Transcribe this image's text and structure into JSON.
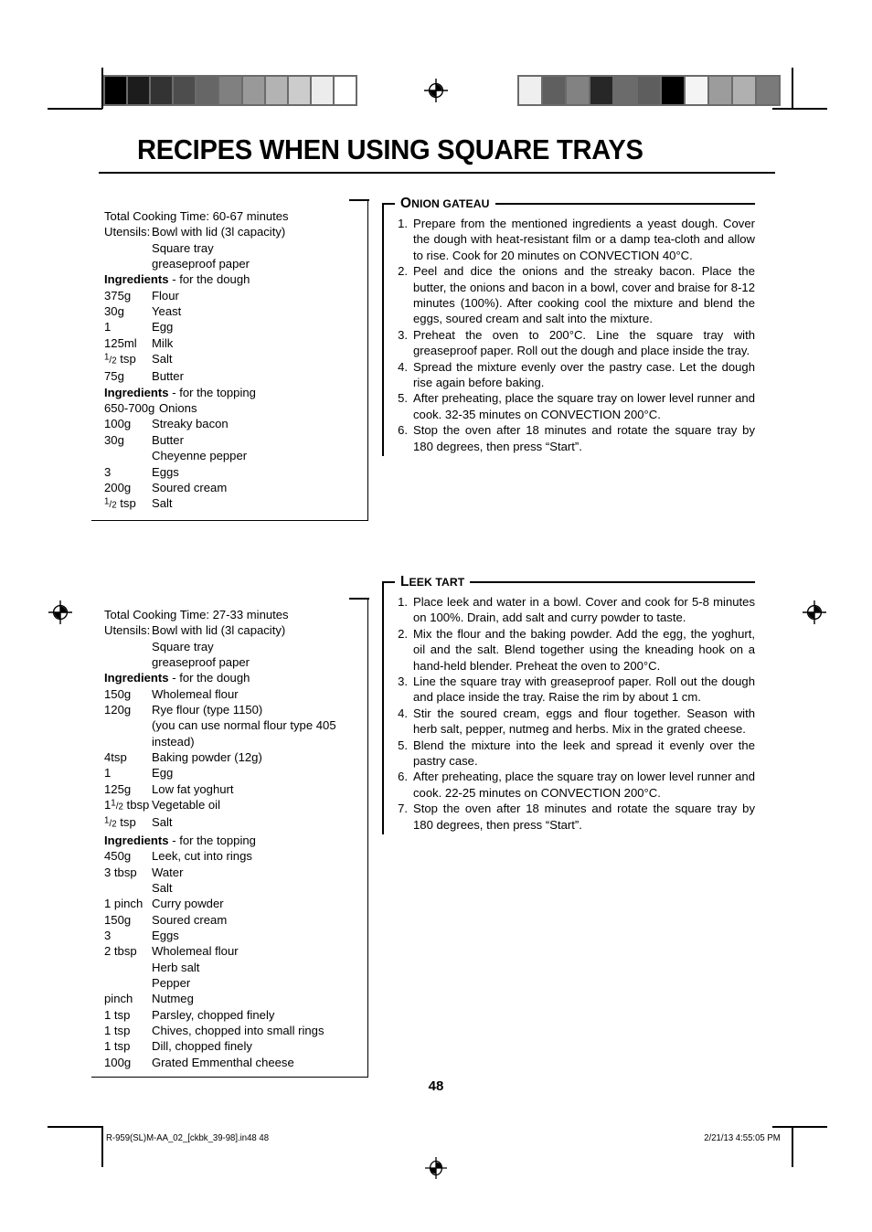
{
  "page_title": "RECIPES WHEN USING SQUARE TRAYS",
  "page_number": "48",
  "footer": {
    "file": "R-959(SL)M-AA_02_[ckbk_39-98].in48   48",
    "timestamp": "2/21/13   4:55:05 PM"
  },
  "print_marks": {
    "left_bar_label": "grayscale-step-wedge",
    "left_bar_colors": [
      "#000000",
      "#1c1c1c",
      "#333333",
      "#4d4d4d",
      "#666666",
      "#808080",
      "#999999",
      "#b3b3b3",
      "#cccccc",
      "#ececec",
      "#ffffff"
    ],
    "right_bar_colors": [
      "#efefef",
      "#5f5f5f",
      "#828282",
      "#272727",
      "#6b6b6b",
      "#5e5e5e",
      "#000000",
      "#f4f4f4",
      "#9c9c9c",
      "#b0b0b0",
      "#7a7a7a"
    ],
    "registration_icon": "registration-target-icon"
  },
  "recipes": [
    {
      "id": "onion-gateau",
      "title_first": "O",
      "title_rest": "NION GATEAU",
      "ingredients": {
        "cooking_time_label": "Total Cooking Time:",
        "cooking_time_value": "60-67 minutes",
        "utensils_label": "Utensils:",
        "utensils": [
          "Bowl with lid (3l capacity)",
          "Square tray",
          "greaseproof paper"
        ],
        "sections": [
          {
            "heading_bold": "Ingredients",
            "heading_rest": " - for the dough",
            "items": [
              {
                "qty": "375g",
                "name": "Flour"
              },
              {
                "qty": "30g",
                "name": "Yeast"
              },
              {
                "qty": "1",
                "name": "Egg"
              },
              {
                "qty": "125ml",
                "name": "Milk"
              },
              {
                "qty": "1/2 tsp",
                "qty_frac": true,
                "qty_num": "1",
                "qty_den": "2",
                "qty_unit": " tsp",
                "name": "Salt"
              },
              {
                "qty": "75g",
                "name": "Butter"
              }
            ]
          },
          {
            "heading_bold": "Ingredients",
            "heading_rest": " - for the topping",
            "items": [
              {
                "qty": "650-700g",
                "name": "Onions",
                "wide": true
              },
              {
                "qty": "100g",
                "name": "Streaky bacon"
              },
              {
                "qty": "30g",
                "name": "Butter"
              },
              {
                "qty": "",
                "name": "Cheyenne pepper"
              },
              {
                "qty": "3",
                "name": "Eggs"
              },
              {
                "qty": "200g",
                "name": "Soured cream"
              },
              {
                "qty": "1/2 tsp",
                "qty_frac": true,
                "qty_num": "1",
                "qty_den": "2",
                "qty_unit": " tsp",
                "name": "Salt"
              }
            ]
          }
        ]
      },
      "steps": [
        "Prepare from the mentioned ingredients a yeast dough. Cover the dough with heat-resistant film or a damp tea-cloth and allow to rise. Cook for 20 minutes on CONVECTION 40°C.",
        "Peel and dice the onions and the streaky bacon. Place the butter, the onions and bacon in a bowl, cover and braise for 8-12 minutes (100%). After cooking cool the mixture and blend the eggs, soured cream and salt into the mixture.",
        "Preheat the oven to 200°C. Line the square tray with greaseproof paper. Roll out the dough and place inside the tray.",
        "Spread the mixture evenly over the pastry case. Let the dough rise again before baking.",
        "After preheating, place the square tray on lower level runner and cook. 32-35 minutes on CONVECTION 200°C.",
        "Stop the oven after 18 minutes and rotate the square tray by 180 degrees, then press “Start”."
      ]
    },
    {
      "id": "leek-tart",
      "title_first": "L",
      "title_rest": "EEK TART",
      "ingredients": {
        "cooking_time_label": "Total Cooking Time:",
        "cooking_time_value": "27-33 minutes",
        "utensils_label": "Utensils:",
        "utensils": [
          "Bowl with lid (3l capacity)",
          "Square tray",
          "greaseproof paper"
        ],
        "sections": [
          {
            "heading_bold": "Ingredients",
            "heading_rest": " - for the dough",
            "items": [
              {
                "qty": "150g",
                "name": "Wholemeal flour"
              },
              {
                "qty": "120g",
                "name": "Rye flour (type 1150)"
              },
              {
                "qty": "",
                "name": "(you can use normal flour type 405",
                "overflow": true
              },
              {
                "qty": "",
                "name": "instead)"
              },
              {
                "qty": "4tsp",
                "name": "Baking powder (12g)"
              },
              {
                "qty": "1",
                "name": "Egg"
              },
              {
                "qty": "125g",
                "name": "Low fat yoghurt"
              },
              {
                "qty": "1 1/2 tbsp",
                "qty_frac": true,
                "qty_whole": "1",
                "qty_num": "1",
                "qty_den": "2",
                "qty_unit": " tbsp",
                "name": "Vegetable oil"
              },
              {
                "qty": "1/2 tsp",
                "qty_frac": true,
                "qty_num": "1",
                "qty_den": "2",
                "qty_unit": " tsp",
                "name": "Salt"
              }
            ]
          },
          {
            "heading_bold": "Ingredients",
            "heading_rest": " - for the topping",
            "items": [
              {
                "qty": "450g",
                "name": "Leek, cut into rings"
              },
              {
                "qty": "3 tbsp",
                "name": "Water"
              },
              {
                "qty": "",
                "name": "Salt"
              },
              {
                "qty": "1 pinch",
                "name": "Curry powder"
              },
              {
                "qty": "150g",
                "name": "Soured cream"
              },
              {
                "qty": "3",
                "name": "Eggs"
              },
              {
                "qty": "2 tbsp",
                "name": "Wholemeal flour"
              },
              {
                "qty": "",
                "name": "Herb salt"
              },
              {
                "qty": "",
                "name": "Pepper"
              },
              {
                "qty": "pinch",
                "name": "Nutmeg"
              },
              {
                "qty": "1 tsp",
                "name": "Parsley, chopped finely"
              },
              {
                "qty": "1 tsp",
                "name": "Chives, chopped into small rings"
              },
              {
                "qty": "1 tsp",
                "name": "Dill, chopped finely"
              },
              {
                "qty": "100g",
                "name": "Grated Emmenthal cheese"
              }
            ]
          }
        ]
      },
      "steps": [
        "Place leek and water in a bowl. Cover and cook for 5-8 minutes on 100%. Drain, add salt and curry powder to taste.",
        "Mix the flour and the baking powder. Add the egg, the yoghurt, oil and the salt. Blend together using the kneading hook on a hand-held blender. Preheat the oven to 200°C.",
        "Line the square tray with greaseproof paper. Roll out the dough and place inside the tray. Raise the rim by about 1 cm.",
        "Stir the soured cream, eggs and flour together. Season with herb salt, pepper, nutmeg and herbs. Mix in the grated cheese.",
        "Blend the mixture into the leek and spread it evenly over the pastry case.",
        "After preheating, place the square tray on lower level runner and cook. 22-25 minutes on CONVECTION 200°C.",
        "Stop the oven after 18 minutes and rotate the square tray by 180 degrees, then press “Start”."
      ]
    }
  ]
}
